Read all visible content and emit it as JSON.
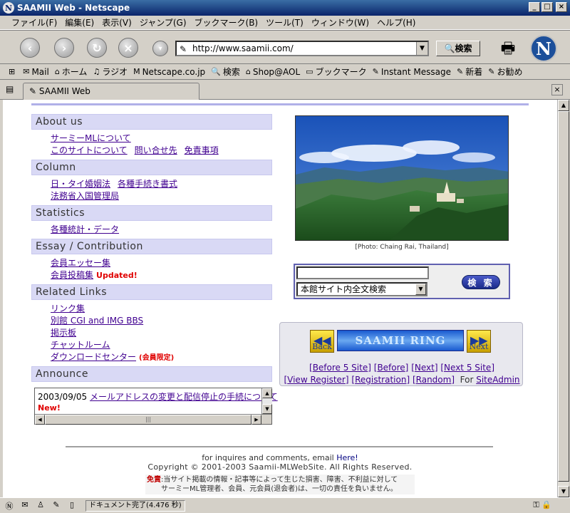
{
  "window": {
    "title": "SAAMII Web - Netscape",
    "app_icon": "N"
  },
  "menu": [
    "ファイル(F)",
    "編集(E)",
    "表示(V)",
    "ジャンプ(G)",
    "ブックマーク(B)",
    "ツール(T)",
    "ウィンドウ(W)",
    "ヘルプ(H)"
  ],
  "nav": {
    "url": "http://www.saamii.com/",
    "search_label": "検索"
  },
  "personal_toolbar": [
    "Mail",
    "ホーム",
    "ラジオ",
    "Netscape.co.jp",
    "検索",
    "Shop@AOL",
    "ブックマーク",
    "Instant Message",
    "新着",
    "お勧め"
  ],
  "tab": {
    "label": "SAAMII Web"
  },
  "sections": [
    {
      "title": "About us",
      "rows": [
        [
          {
            "text": "サーミーMLについて"
          }
        ],
        [
          {
            "text": "このサイトについて"
          },
          {
            "text": "問い合せ先"
          },
          {
            "text": "免責事項"
          }
        ]
      ]
    },
    {
      "title": "Column",
      "rows": [
        [
          {
            "text": "日・タイ婚姻法"
          },
          {
            "text": "各種手続き書式"
          }
        ],
        [
          {
            "text": "法務省入国管理局"
          }
        ]
      ]
    },
    {
      "title": "Statistics",
      "rows": [
        [
          {
            "text": "各種統計・データ"
          }
        ]
      ]
    },
    {
      "title": "Essay / Contribution",
      "rows": [
        [
          {
            "text": "会員エッセー集"
          }
        ],
        [
          {
            "text": "会員投稿集",
            "badge": "Updated!"
          }
        ]
      ]
    },
    {
      "title": "Related Links",
      "rows": [
        [
          {
            "text": "リンク集"
          }
        ],
        [
          {
            "text": "別館 CGI and IMG BBS"
          }
        ],
        [
          {
            "text": "掲示板"
          }
        ],
        [
          {
            "text": "チャットルーム"
          }
        ],
        [
          {
            "text": "ダウンロードセンター",
            "badge": "(会員限定)"
          }
        ]
      ]
    },
    {
      "title": "Announce",
      "rows": []
    }
  ],
  "announce": {
    "date": "2003/09/05",
    "link": "メールアドレスの変更と配信停止の手続について",
    "new_badge": "New!",
    "hscroll_thumb": "|||"
  },
  "photo": {
    "caption": "[Photo: Chaing Rai, Thailand]"
  },
  "search_box": {
    "select_value": "本館サイト内全文検索",
    "button": "検 索"
  },
  "ring": {
    "logo": "SAAMII RING",
    "back": "Back",
    "next": "Next",
    "row1": [
      "Before 5 Site",
      "Before",
      "Next",
      "Next 5 Site"
    ],
    "row2": [
      "View Register",
      "Registration",
      "Random"
    ],
    "for_label": "For",
    "admin": "SiteAdmin"
  },
  "footer": {
    "line1": "for inquires and comments, email",
    "here": "Here!",
    "copyright": "Copyright © 2001-2003 Saamii-MLWebSite. All Rights Reserved.",
    "disclaimer_label": "免責",
    "disclaimer_line1": ":当サイト掲載の情報・記事等によって生じた損害、障害、不利益に対して",
    "disclaimer_line2": "サーミーML管理者、会員、元会員(退会者)は、一切の責任を負いません。"
  },
  "status": {
    "text": "ドキュメント完了(4.476 秒)"
  },
  "colors": {
    "section_bg": "#d9d9f5",
    "link": "#400090",
    "alert": "#e00000"
  }
}
